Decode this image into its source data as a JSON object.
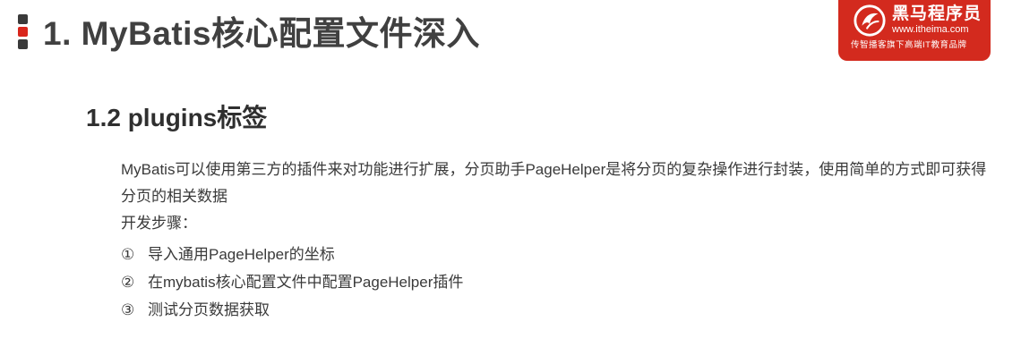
{
  "header": {
    "title": "1. MyBatis核心配置文件深入"
  },
  "logo": {
    "name": "黑马程序员",
    "url": "www.itheima.com",
    "slogan": "传智播客旗下高端IT教育品牌",
    "icon": "itheima-logo-icon",
    "color": "#d32a1e"
  },
  "section": {
    "subtitle": "1.2 plugins标签",
    "description": "MyBatis可以使用第三方的插件来对功能进行扩展，分页助手PageHelper是将分页的复杂操作进行封装，使用简单的方式即可获得分页的相关数据",
    "steps_label": "开发步骤：",
    "steps": [
      {
        "num": "①",
        "text": "导入通用PageHelper的坐标"
      },
      {
        "num": "②",
        "text": "在mybatis核心配置文件中配置PageHelper插件"
      },
      {
        "num": "③",
        "text": "测试分页数据获取"
      }
    ]
  }
}
